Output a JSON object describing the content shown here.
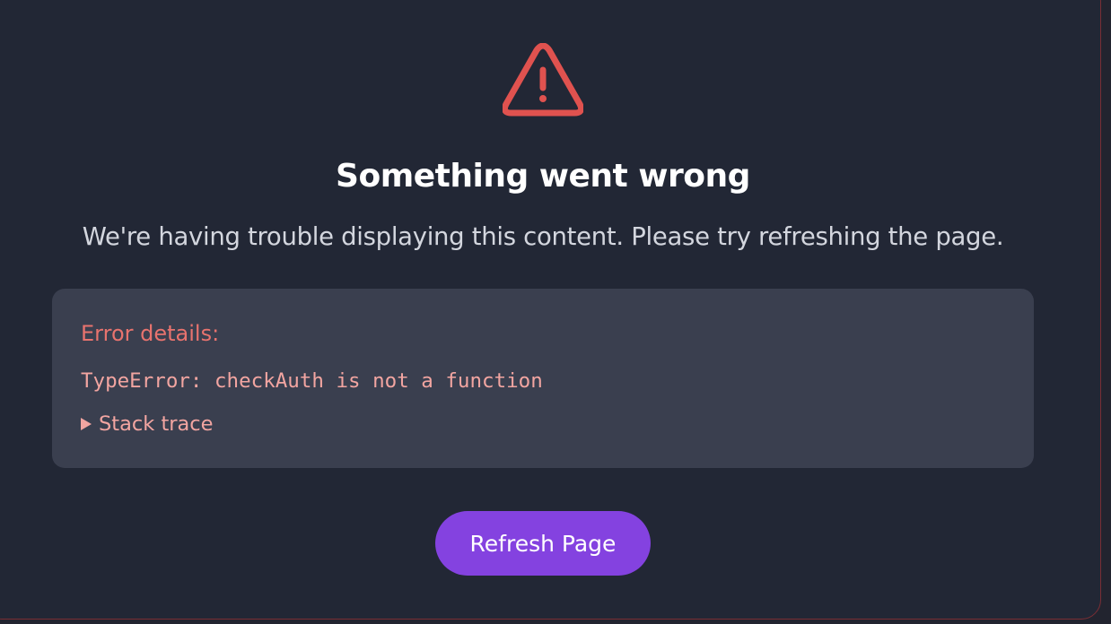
{
  "error": {
    "title": "Something went wrong",
    "message": "We're having trouble displaying this content. Please try refreshing the page.",
    "details_heading": "Error details:",
    "error_text": "TypeError: checkAuth is not a function",
    "stack_trace_label": "Stack trace",
    "refresh_label": "Refresh Page",
    "icon": "warning-triangle-icon"
  },
  "colors": {
    "background": "#222735",
    "accent": "#8442e0",
    "error_red": "#e0524f",
    "error_text": "#f2a5a1"
  }
}
